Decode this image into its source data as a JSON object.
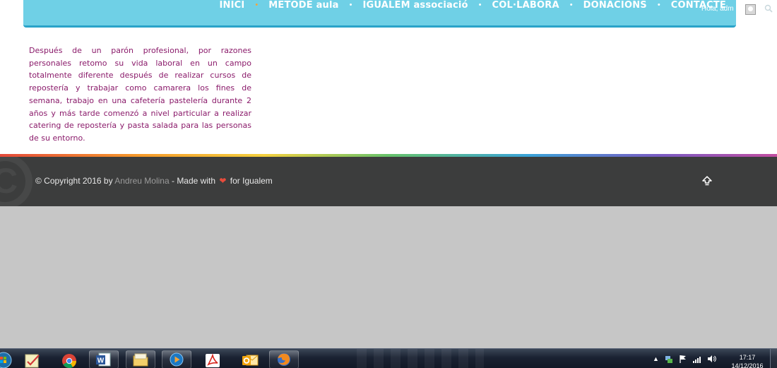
{
  "nav": {
    "items": [
      {
        "label": "INICI"
      },
      {
        "label": "METODE aula"
      },
      {
        "label": "IGUALEM associació"
      },
      {
        "label": "COL·LABORA"
      },
      {
        "label": "DONACIONS"
      },
      {
        "label": "CONTACTE"
      }
    ],
    "separator": "•"
  },
  "admin_bar": {
    "greeting": "Hola, adm",
    "avatar_icon": "user-avatar-icon",
    "search_icon": "search-icon"
  },
  "content": {
    "bio": "Después de un parón profesional, por razones personales retomo su vida laboral en un campo totalmente diferente después de realizar cursos de repostería y trabajar como camarera los fines de semana, trabajo en una cafetería pastelería durante 2 años y más tarde comenzó a nivel particular a realizar catering de repostería y pasta salada para las personas de su entorno."
  },
  "footer": {
    "copyright_prefix": "© Copyright 2016 by",
    "author_link": "Andreu Molina",
    "made_with": "- Made with",
    "heart": "❤",
    "for_text": "for Igualem",
    "scroll_top_icon": "scroll-to-top-icon"
  },
  "taskbar": {
    "apps": [
      {
        "name": "start-orb-icon"
      },
      {
        "name": "sticky-notes-icon"
      },
      {
        "name": "chrome-icon"
      },
      {
        "name": "word-icon"
      },
      {
        "name": "file-explorer-icon"
      },
      {
        "name": "media-player-icon"
      },
      {
        "name": "acrobat-icon"
      },
      {
        "name": "outlook-icon"
      },
      {
        "name": "firefox-icon"
      }
    ],
    "clock_time": "17:17",
    "clock_date": "14/12/2016"
  },
  "colors": {
    "nav_bg": "#6fd0e6",
    "nav_border": "#2aa3c9",
    "bio_text": "#8a1a6a",
    "footer_bg": "#3c3d3d",
    "page_bg": "#c6c6c6",
    "heart": "#e74c3c"
  }
}
